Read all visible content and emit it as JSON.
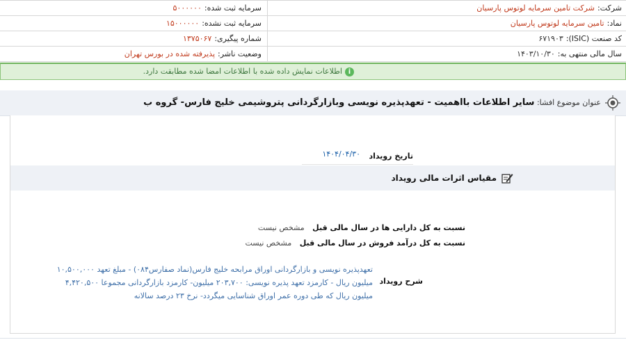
{
  "company_info": {
    "company_label": "شرکت:",
    "company_value": "شرکت تامین سرمایه لوتوس پارسیان",
    "registered_capital_label": "سرمایه ثبت شده:",
    "registered_capital_value": "۵۰۰۰۰۰۰",
    "symbol_label": "نماد:",
    "symbol_value": "تامین سرمایه لوتوس پارسیان",
    "unregistered_capital_label": "سرمایه ثبت نشده:",
    "unregistered_capital_value": "۱۵۰۰۰۰۰۰",
    "isic_label": "کد صنعت (ISIC):",
    "isic_value": "۶۷۱۹۰۳",
    "tracking_label": "شماره پیگیری:",
    "tracking_value": "۱۳۷۵۰۶۷",
    "fiscal_year_label": "سال مالی منتهی به:",
    "fiscal_year_value": "۱۴۰۳/۱۰/۳۰",
    "publisher_status_label": "وضعیت ناشر:",
    "publisher_status_value": "پذیرفته شده در بورس تهران"
  },
  "notice": {
    "text": "اطلاعات نمایش داده شده با اطلاعات امضا شده مطابقت دارد.",
    "icon": "info-icon",
    "color": "#dff0d8"
  },
  "subject": {
    "label": "عنوان موضوع افشا:",
    "title": "سایر اطلاعات بااهمیت - تعهدپذیره نویسی وبازارگردانی پتروشیمی خلیج فارس- گروه ب",
    "icon": "target-icon"
  },
  "event": {
    "date_label": "تاریخ رویداد",
    "date_value": "۱۴۰۴/۰۴/۳۰"
  },
  "financial_effects": {
    "title": "مقیاس اثرات مالی رویداد",
    "icon": "pen-icon",
    "assets_ratio_label": "نسبت به کل دارایی ها در سال مالی قبل",
    "assets_ratio_value": "مشخص نیست",
    "sales_ratio_label": "نسبت به کل درآمد فروش در سال مالی قبل",
    "sales_ratio_value": "مشخص نیست"
  },
  "description": {
    "label": "شرح رویداد",
    "text": "تعهدپذیره نویسی و بازارگردانی اوراق مرابحه خلیج فارس(نماد صفارس۰۸۴) - مبلغ تعهد ۱۰,۵۰۰,۰۰۰ میلیون ریال - کارمزد تعهد پذیره نویسی: ۲۰۳,۷۰۰ میلیون- کارمزد بازارگردانی مجموعا ۴,۴۲۰,۵۰۰ میلیون ریال که طی دوره عمر اوراق شناسایی میگردد- نرخ ۲۳ درصد سالانه"
  },
  "colors": {
    "accent_orange": "#c0391b",
    "link_blue": "#3e6fa8",
    "header_bg": "#eef1f6",
    "success_green": "#3c763d"
  }
}
